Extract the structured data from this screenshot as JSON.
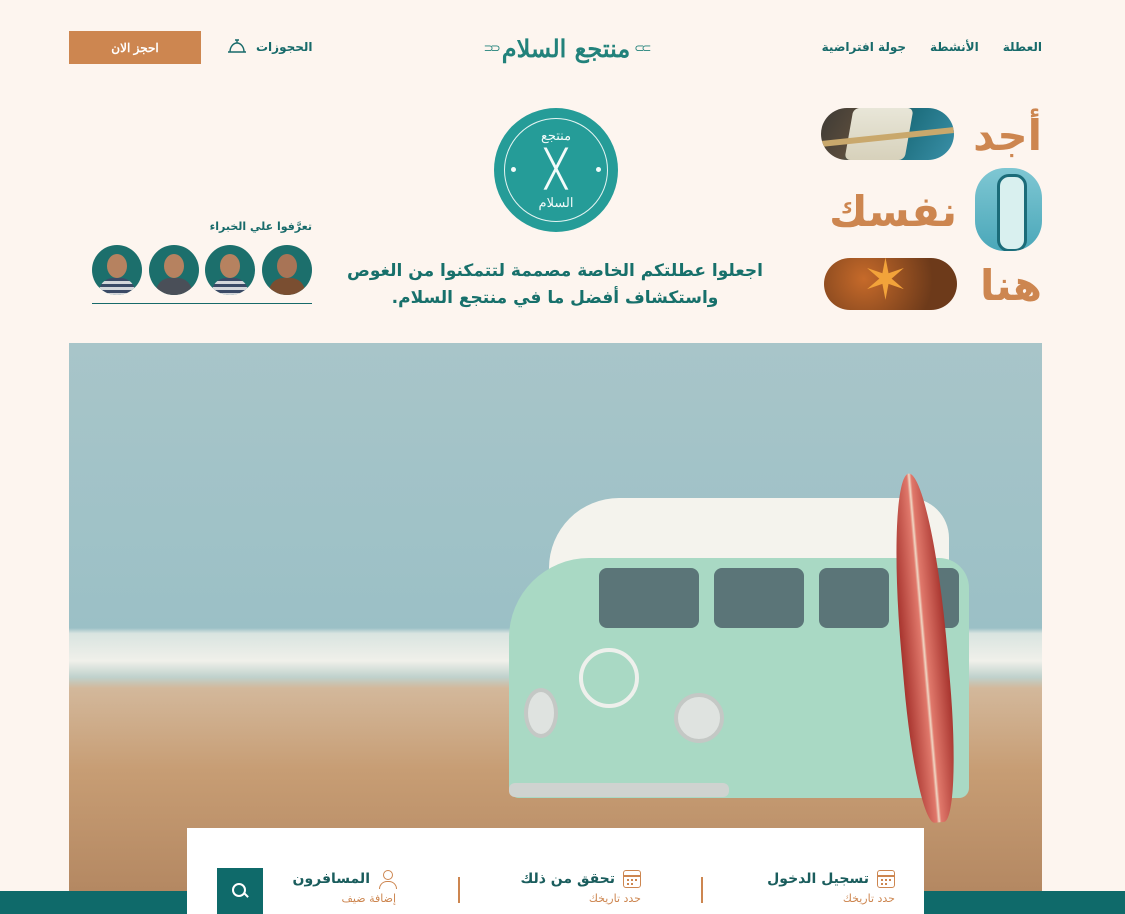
{
  "nav": {
    "links": [
      "العطلة",
      "الأنشطة",
      "جولة افتراضية"
    ],
    "logo_text": "منتجع السلام",
    "bookings_label": "الحجوزات",
    "book_now_label": "احجز الان"
  },
  "hero": {
    "headline": [
      "أجد",
      "نفسك",
      "هنا"
    ],
    "emblem_top": "منتجع",
    "emblem_bottom": "السلام",
    "tagline": "اجعلوا عطلتكم الخاصة مصممة لتتمكنوا من الغوص واستكشاف أفضل ما في منتجع السلام."
  },
  "experts": {
    "title": "تعرَّفوا علي الخبراء",
    "count": 4
  },
  "search": {
    "checkin": {
      "label": "تسجيل الدخول",
      "sub": "حدد تاريخك",
      "icon": "calendar-icon"
    },
    "checkout": {
      "label": "تحقق من ذلك",
      "sub": "حدد تاريخك",
      "icon": "calendar-icon"
    },
    "travelers": {
      "label": "المسافرون",
      "sub": "إضافة ضيف",
      "icon": "user-icon"
    },
    "button_icon": "search-icon"
  },
  "colors": {
    "background": "#fdf5ef",
    "teal": "#0f6a6a",
    "accent": "#cd8650"
  }
}
